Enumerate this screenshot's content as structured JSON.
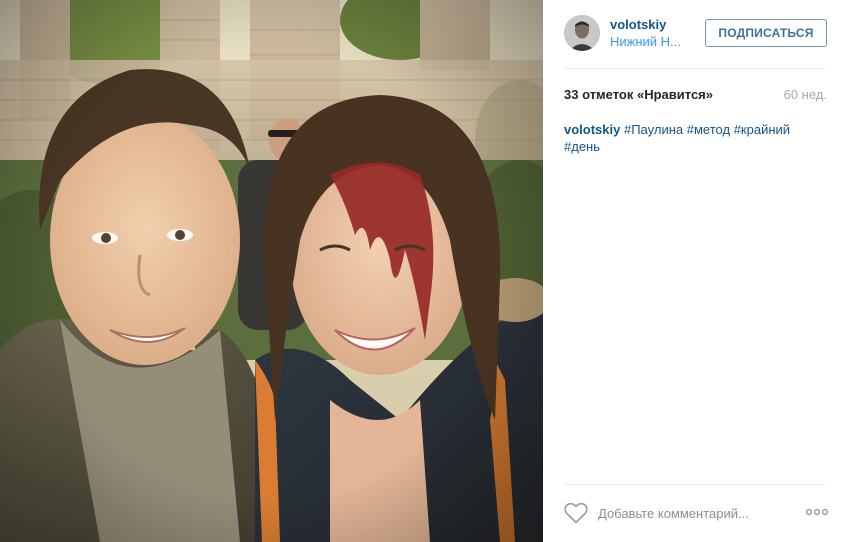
{
  "post": {
    "photo": {
      "icon": "selfie-photo"
    },
    "header": {
      "username": "volotskiy",
      "location": "Нижний Н...",
      "follow_label": "ПОДПИСАТЬСЯ",
      "avatar_icon": "user-avatar"
    },
    "stats": {
      "likes": "33 отметок «Нравится»",
      "age": "60 нед."
    },
    "caption": {
      "username": "volotskiy",
      "tags": [
        "#Паулина",
        "#метод",
        "#крайний",
        "#день"
      ]
    },
    "footer": {
      "like_icon": "heart-icon",
      "comment_placeholder": "Добавьте комментарий...",
      "more_icon": "more-options-icon"
    }
  },
  "colors": {
    "link_blue": "#125688",
    "location_blue": "#3897f0",
    "button_text": "#3f729b",
    "muted": "#a5a7aa"
  }
}
